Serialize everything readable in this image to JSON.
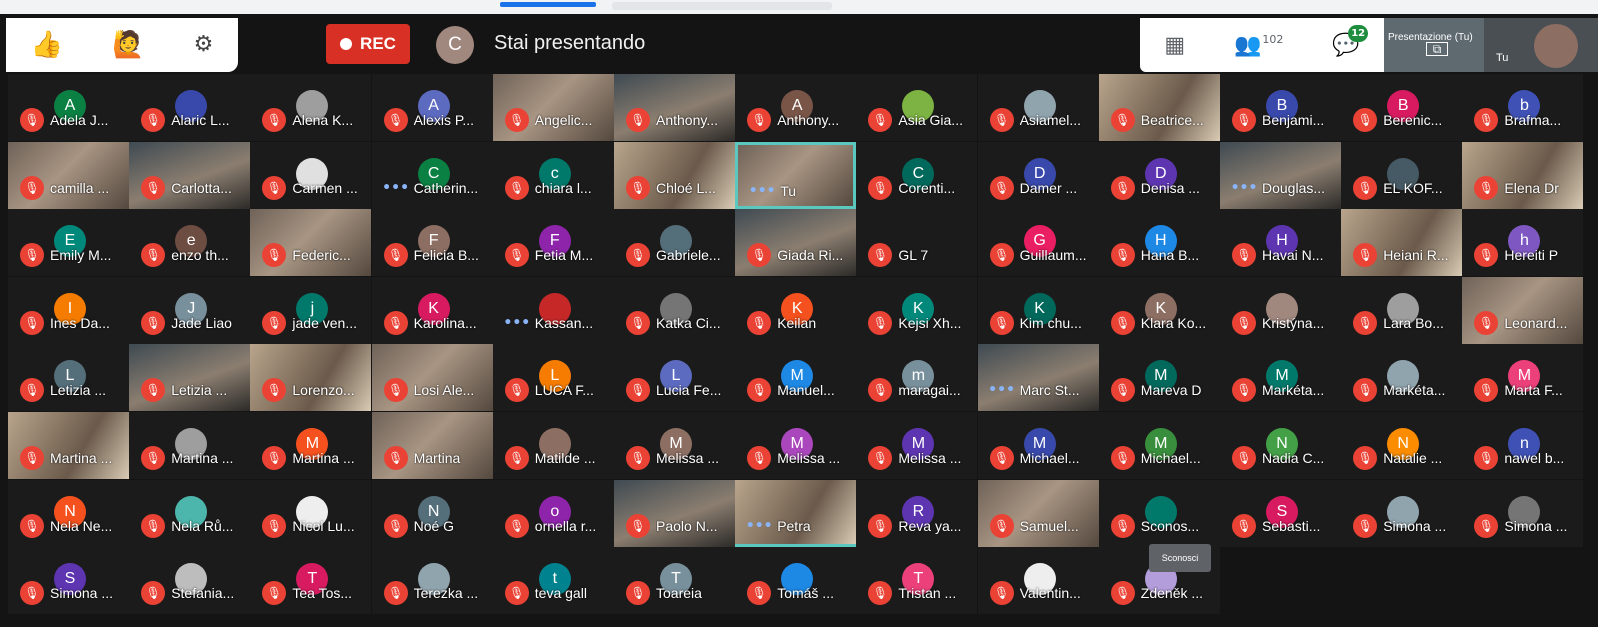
{
  "reactions": {
    "thumbs_icon": "thumbs-up-icon",
    "hand_icon": "raise-hand-icon",
    "settings_icon": "gear-icon"
  },
  "recording": {
    "label": "REC"
  },
  "presenter": {
    "initial": "C",
    "status": "Stai presentando"
  },
  "toolbar": {
    "people_count": "102",
    "chat_badge": "12"
  },
  "self_view": {
    "presentation_label": "Presentazione (Tu)",
    "tu_label": "Tu"
  },
  "colors": {
    "mic_off": "#ea4335",
    "active_border": "#5bc8c0",
    "rec": "#d93025"
  },
  "participants": [
    [
      {
        "name": "Adela J...",
        "initial": "A",
        "color": "#0b8043"
      },
      {
        "name": "Alaric L...",
        "initial": "",
        "color": "#3949ab"
      },
      {
        "name": "Alena K...",
        "initial": "",
        "color": "#9e9e9e"
      },
      {
        "name": "Alexis P...",
        "initial": "A",
        "color": "#5c6bc0"
      },
      {
        "name": "Angelic...",
        "initial": "",
        "color": "",
        "video": true
      },
      {
        "name": "Anthony...",
        "initial": "",
        "color": "",
        "video": true
      },
      {
        "name": "Anthony...",
        "initial": "A",
        "color": "#795548"
      },
      {
        "name": "Asia Gia...",
        "initial": "",
        "color": "#7cb342"
      },
      {
        "name": "Asiamel...",
        "initial": "",
        "color": "#90a4ae"
      },
      {
        "name": "Beatrice...",
        "initial": "",
        "color": "",
        "video": true
      },
      {
        "name": "Benjami...",
        "initial": "B",
        "color": "#3949ab"
      },
      {
        "name": "Berenic...",
        "initial": "B",
        "color": "#d81b60"
      },
      {
        "name": "Brafma...",
        "initial": "b",
        "color": "#3f51b5"
      }
    ],
    [
      {
        "name": "camilla ...",
        "initial": "",
        "color": "",
        "video": true
      },
      {
        "name": "Carlotta...",
        "initial": "",
        "color": "",
        "video": true
      },
      {
        "name": "Carmen ...",
        "initial": "",
        "color": "#e0e0e0"
      },
      {
        "name": "Catherin...",
        "initial": "C",
        "color": "#0b8043",
        "talking": true
      },
      {
        "name": "chiara l...",
        "initial": "c",
        "color": "#00796b"
      },
      {
        "name": "Chloé L...",
        "initial": "",
        "color": "",
        "video": true
      },
      {
        "name": "Tu",
        "initial": "",
        "color": "",
        "video": true,
        "active": true,
        "talking": true
      },
      {
        "name": "Corenti...",
        "initial": "C",
        "color": "#00695c"
      },
      {
        "name": "Damer ...",
        "initial": "D",
        "color": "#3949ab"
      },
      {
        "name": "Denisa ...",
        "initial": "D",
        "color": "#5e35b1"
      },
      {
        "name": "Douglas...",
        "initial": "",
        "color": "",
        "video": true,
        "talking": true
      },
      {
        "name": "EL KOF...",
        "initial": "",
        "color": "#455a64"
      },
      {
        "name": "Elena Dr",
        "initial": "",
        "color": "",
        "video": true
      }
    ],
    [
      {
        "name": "Emily M...",
        "initial": "E",
        "color": "#00897b"
      },
      {
        "name": "enzo th...",
        "initial": "e",
        "color": "#6d4c41"
      },
      {
        "name": "Federic...",
        "initial": "",
        "color": "",
        "video": true
      },
      {
        "name": "Felicia B...",
        "initial": "F",
        "color": "#8d6e63"
      },
      {
        "name": "Fetia M...",
        "initial": "F",
        "color": "#8e24aa"
      },
      {
        "name": "Gabriele...",
        "initial": "",
        "color": "#546e7a"
      },
      {
        "name": "Giada Ri...",
        "initial": "",
        "color": "",
        "video": true
      },
      {
        "name": "GL 7",
        "initial": "",
        "color": ""
      },
      {
        "name": "Guillaum...",
        "initial": "G",
        "color": "#e91e63"
      },
      {
        "name": "Hana B...",
        "initial": "H",
        "color": "#1e88e5"
      },
      {
        "name": "Havai N...",
        "initial": "H",
        "color": "#5e35b1"
      },
      {
        "name": "Heiani R...",
        "initial": "",
        "color": "",
        "video": true
      },
      {
        "name": "Hereiti P",
        "initial": "h",
        "color": "#7e57c2"
      }
    ],
    [
      {
        "name": "Ines Da...",
        "initial": "I",
        "color": "#f57c00"
      },
      {
        "name": "Jade Liao",
        "initial": "J",
        "color": "#78909c"
      },
      {
        "name": "jade ven...",
        "initial": "j",
        "color": "#00796b"
      },
      {
        "name": "Karolina...",
        "initial": "K",
        "color": "#d81b60"
      },
      {
        "name": "Kassan...",
        "initial": "",
        "color": "#c62828",
        "talking": true
      },
      {
        "name": "Katka Ci...",
        "initial": "",
        "color": "#757575"
      },
      {
        "name": "Keilan",
        "initial": "K",
        "color": "#f4511e"
      },
      {
        "name": "Kejsi Xh...",
        "initial": "K",
        "color": "#00897b"
      },
      {
        "name": "Kim chu...",
        "initial": "K",
        "color": "#00695c"
      },
      {
        "name": "Klara Ko...",
        "initial": "K",
        "color": "#8d6e63"
      },
      {
        "name": "Kristýna...",
        "initial": "",
        "color": "#a1887f"
      },
      {
        "name": "Lara Bo...",
        "initial": "",
        "color": "#9e9e9e"
      },
      {
        "name": "Leonard...",
        "initial": "",
        "color": "",
        "video": true
      }
    ],
    [
      {
        "name": "Letizia ...",
        "initial": "L",
        "color": "#546e7a"
      },
      {
        "name": "Letizia ...",
        "initial": "",
        "color": "",
        "video": true
      },
      {
        "name": "Lorenzo...",
        "initial": "",
        "color": "",
        "video": true
      },
      {
        "name": "Losi Ale...",
        "initial": "",
        "color": "",
        "video": true
      },
      {
        "name": "LUCA F...",
        "initial": "L",
        "color": "#f57c00"
      },
      {
        "name": "Lucia Fe...",
        "initial": "L",
        "color": "#5c6bc0"
      },
      {
        "name": "Manuel...",
        "initial": "M",
        "color": "#1e88e5"
      },
      {
        "name": "maragai...",
        "initial": "m",
        "color": "#78909c"
      },
      {
        "name": "Marc St...",
        "initial": "",
        "color": "",
        "video": true,
        "talking": true
      },
      {
        "name": "Mareva D",
        "initial": "M",
        "color": "#00695c"
      },
      {
        "name": "Markéta...",
        "initial": "M",
        "color": "#00796b"
      },
      {
        "name": "Markéta...",
        "initial": "",
        "color": "#90a4ae"
      },
      {
        "name": "Marta F...",
        "initial": "M",
        "color": "#ec407a"
      }
    ],
    [
      {
        "name": "Martina ...",
        "initial": "",
        "color": "",
        "video": true
      },
      {
        "name": "Martina ...",
        "initial": "",
        "color": "#9e9e9e"
      },
      {
        "name": "Martina ...",
        "initial": "M",
        "color": "#f4511e"
      },
      {
        "name": "Martina",
        "initial": "",
        "color": "",
        "video": true
      },
      {
        "name": "Matilde ...",
        "initial": "",
        "color": "#8d6e63"
      },
      {
        "name": "Melissa ...",
        "initial": "M",
        "color": "#8d6e63"
      },
      {
        "name": "Melissa ...",
        "initial": "M",
        "color": "#ab47bc"
      },
      {
        "name": "Melissa ...",
        "initial": "M",
        "color": "#5e35b1"
      },
      {
        "name": "Michael...",
        "initial": "M",
        "color": "#3949ab"
      },
      {
        "name": "Michael...",
        "initial": "M",
        "color": "#388e3c"
      },
      {
        "name": "Nadia C...",
        "initial": "N",
        "color": "#43a047"
      },
      {
        "name": "Natalie ...",
        "initial": "N",
        "color": "#fb8c00"
      },
      {
        "name": "nawel b...",
        "initial": "n",
        "color": "#3f51b5"
      }
    ],
    [
      {
        "name": "Nela Ne...",
        "initial": "N",
        "color": "#f4511e"
      },
      {
        "name": "Nela Rů...",
        "initial": "",
        "color": "#4db6ac"
      },
      {
        "name": "Nicol Lu...",
        "initial": "",
        "color": "#eeeeee"
      },
      {
        "name": "Noé G",
        "initial": "N",
        "color": "#546e7a"
      },
      {
        "name": "ornella r...",
        "initial": "o",
        "color": "#8e24aa"
      },
      {
        "name": "Paolo N...",
        "initial": "",
        "color": "",
        "video": true
      },
      {
        "name": "Petra",
        "initial": "",
        "color": "",
        "video": true,
        "active_bottom": true,
        "talking": true
      },
      {
        "name": "Reva ya...",
        "initial": "R",
        "color": "#5e35b1"
      },
      {
        "name": "Samuel...",
        "initial": "",
        "color": "",
        "video": true
      },
      {
        "name": "Sconos...",
        "initial": "",
        "color": "#00796b"
      },
      {
        "name": "Sebasti...",
        "initial": "S",
        "color": "#d81b60"
      },
      {
        "name": "Simona ...",
        "initial": "",
        "color": "#90a4ae"
      },
      {
        "name": "Simona ...",
        "initial": "",
        "color": "#757575"
      }
    ],
    [
      {
        "name": "Simona ...",
        "initial": "S",
        "color": "#5e35b1"
      },
      {
        "name": "Stefania...",
        "initial": "",
        "color": "#bdbdbd"
      },
      {
        "name": "Tea Tos...",
        "initial": "T",
        "color": "#d81b60"
      },
      {
        "name": "Terezka ...",
        "initial": "",
        "color": "#90a4ae"
      },
      {
        "name": "teva gall",
        "initial": "t",
        "color": "#00838f"
      },
      {
        "name": "Toareia",
        "initial": "T",
        "color": "#78909c"
      },
      {
        "name": "Tomáš ...",
        "initial": "",
        "color": "#1e88e5"
      },
      {
        "name": "Tristan ...",
        "initial": "T",
        "color": "#ec407a"
      },
      {
        "name": "Valentin...",
        "initial": "",
        "color": "#eeeeee"
      },
      {
        "name": "Zdeněk ...",
        "initial": "",
        "color": "#b39ddb"
      }
    ]
  ],
  "tooltip": {
    "text": "Sconosci"
  }
}
